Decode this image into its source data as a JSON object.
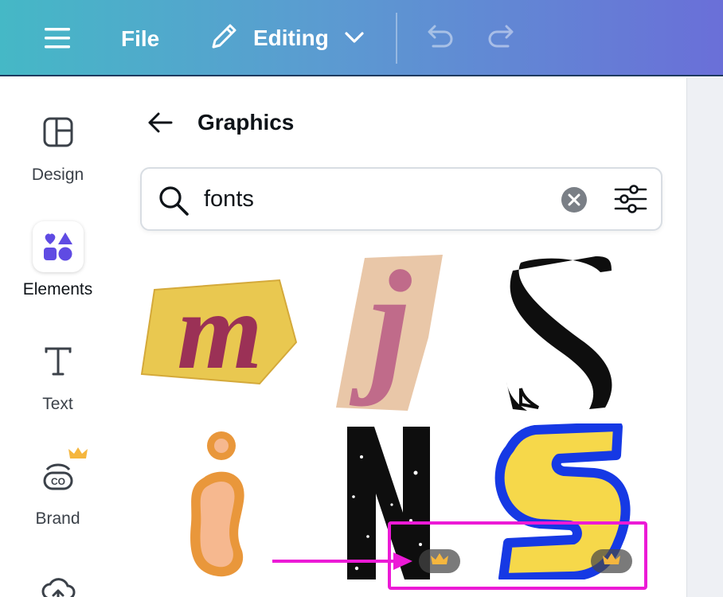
{
  "topbar": {
    "menu_icon": "hamburger-icon",
    "file_label": "File",
    "editing_label": "Editing",
    "editing_icon": "pencil-icon",
    "dropdown_icon": "chevron-down-icon",
    "undo_icon": "undo-icon",
    "redo_icon": "redo-icon",
    "gradient_start": "#45b8c6",
    "gradient_end": "#6a6fd8"
  },
  "sidebar": {
    "items": [
      {
        "label": "Design",
        "icon": "layout-icon"
      },
      {
        "label": "Elements",
        "icon": "shapes-icon",
        "active": true,
        "accent": "#5f4be3"
      },
      {
        "label": "Text",
        "icon": "text-icon"
      },
      {
        "label": "Brand",
        "icon": "brand-icon",
        "premium": true
      },
      {
        "label": "",
        "icon": "upload-icon"
      }
    ]
  },
  "panel": {
    "back_icon": "back-arrow-icon",
    "title": "Graphics",
    "search": {
      "value": "fonts",
      "placeholder": "",
      "search_icon": "search-icon",
      "clear_icon": "clear-icon",
      "filter_icon": "filter-icon"
    },
    "graphics": [
      {
        "name": "letter-m",
        "premium": false
      },
      {
        "name": "letter-j",
        "premium": false
      },
      {
        "name": "letter-s-black",
        "premium": false
      },
      {
        "name": "letter-i",
        "premium": false
      },
      {
        "name": "letter-n",
        "premium": true
      },
      {
        "name": "letter-s-yellow",
        "premium": true
      }
    ],
    "premium_icon": "crown-icon",
    "crown_color": "#f5b63e"
  },
  "annotation": {
    "color": "#ec1ad6"
  }
}
